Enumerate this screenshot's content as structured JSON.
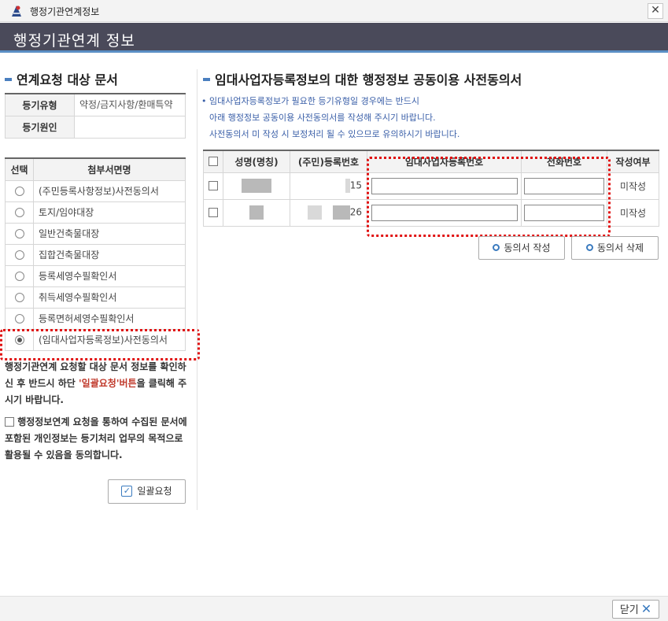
{
  "window": {
    "title": "행정기관연계정보",
    "close_icon": "close-icon"
  },
  "header": {
    "title": "행정기관연계 정보"
  },
  "left": {
    "section_title": "연계요청 대상 문서",
    "info": [
      {
        "label": "등기유형",
        "value": "약정/금지사항/환매특약"
      },
      {
        "label": "등기원인",
        "value": ""
      }
    ],
    "doc_table": {
      "headers": [
        "선택",
        "첨부서면명"
      ],
      "rows": [
        {
          "name": "(주민등록사항정보)사전동의서",
          "selected": false
        },
        {
          "name": "토지/임야대장",
          "selected": false
        },
        {
          "name": "일반건축물대장",
          "selected": false
        },
        {
          "name": "집합건축물대장",
          "selected": false
        },
        {
          "name": "등록세영수필확인서",
          "selected": false
        },
        {
          "name": "취득세영수필확인서",
          "selected": false
        },
        {
          "name": "등록면허세영수필확인서",
          "selected": false
        },
        {
          "name": "(임대사업자등록정보)사전동의서",
          "selected": true
        }
      ]
    },
    "notice_part1": "행정기관연계 요청할 대상 문서 정보를 확인하신 후 반드시 하단 ",
    "notice_highlight": "'일괄요청'버튼",
    "notice_part2": "을 클릭해 주시기 바랍니다.",
    "consent_text": "행정정보연계 요청을 통하여 수집된 문서에 포함된 개인정보는 등기처리 업무의 목적으로 활용될 수 있음을 동의합니다.",
    "bulk_button": "일괄요청"
  },
  "right": {
    "section_title": "임대사업자등록정보의 대한 행정정보 공동이용 사전동의서",
    "guide": [
      "• 임대사업자등록정보가 필요한 등기유형일 경우에는 반드시",
      "아래 행정정보 공동이용 사전동의서를 작성해 주시기 바랍니다.",
      "사전동의서 미 작성 시 보정처리 될 수 있으므로 유의하시기 바랍니다."
    ],
    "table": {
      "headers": [
        "성명(명칭)",
        "(주민)등록번호",
        "임대사업자등록번호",
        "전화번호",
        "작성여부"
      ],
      "rows": [
        {
          "reg_suffix": "15",
          "rental_no": "",
          "phone": "",
          "status": "미작성"
        },
        {
          "reg_suffix": "26",
          "rental_no": "",
          "phone": "",
          "status": "미작성"
        }
      ]
    },
    "write_button": "동의서 작성",
    "delete_button": "동의서 삭제"
  },
  "footer": {
    "close_button": "닫기"
  },
  "colors": {
    "header_bg": "#4a4a5a",
    "accent": "#5b8fc5",
    "highlight": "#e01010",
    "notice_red": "#c0392b"
  }
}
